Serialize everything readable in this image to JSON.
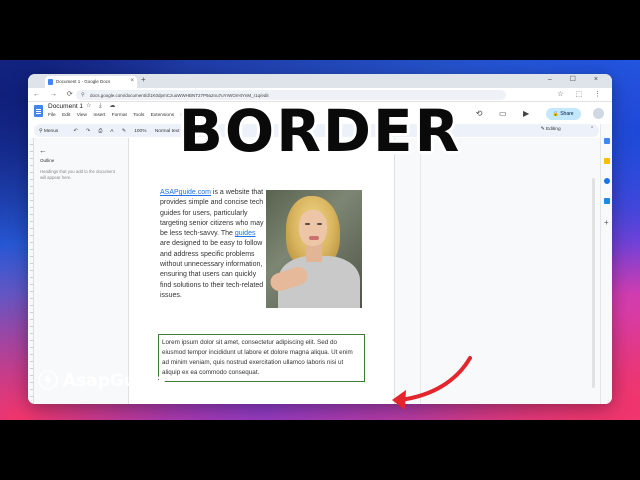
{
  "overlay": {
    "headline": "BORDER",
    "brand": "AsapGuide"
  },
  "browser": {
    "tab_title": "Document 1 - Google Docs",
    "tab_close": "×",
    "new_tab": "+",
    "window_controls": "– ☐ ×",
    "nav": "← → ⟳",
    "url": "docs.google.com/document/d/1K0dpmCzuuWWHBNT27P9a2nu7uYrWOrHtYnM_r1q/edit",
    "extensions": "☆ ⬚ ⋮"
  },
  "docs": {
    "title": "Document 1",
    "title_icons": "☆ ⤓ ☁",
    "menu": [
      "File",
      "Edit",
      "View",
      "Insert",
      "Format",
      "Tools",
      "Extensions",
      "Help"
    ],
    "share_label": "Share",
    "header_icons": {
      "history": "history-icon",
      "comment": "comment-icon",
      "meet": "video-icon"
    }
  },
  "toolbar": {
    "menus_label": "Menus",
    "undo": "↶",
    "redo": "↷",
    "print": "⎙",
    "spellcheck": "A",
    "paint": "✎",
    "zoom": "100%",
    "style": "Normal text",
    "editing_label": "Editing",
    "collapse": "⌃"
  },
  "outline": {
    "back": "←",
    "title": "Outline",
    "hint": "Headings that you add to the document will appear here."
  },
  "document": {
    "para1": {
      "link1": "ASAPguide.com",
      "text1": " is a website that provides simple and concise tech guides for users, particularly targeting senior citizens who may be less tech-savvy. The ",
      "link2": "guides",
      "text2": " are designed to be easy to follow and address specific problems without unnecessary information, ensuring that users can quickly find solutions to their tech-related issues."
    },
    "para2": "Lorem ipsum dolor sit amet, consectetur adipiscing elit. Sed do eiusmod tempor incididunt ut labore et dolore magna aliqua. Ut enim ad minim veniam, quis nostrud exercitation ullamco laboris nisi ut aliquip ex ea commodo consequat."
  },
  "colors": {
    "border_green": "#3f7a36",
    "link_blue": "#1a73e8",
    "share_bg": "#c2e7ff",
    "arrow_red": "#e3262d"
  }
}
